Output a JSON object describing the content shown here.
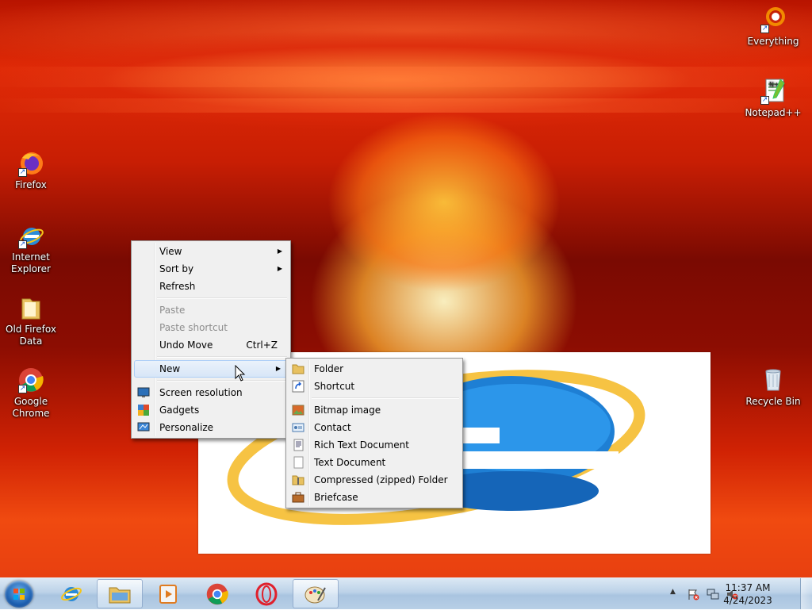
{
  "desktop": {
    "icons": [
      {
        "id": "everything",
        "label": "Everything",
        "icon": "everything-icon"
      },
      {
        "id": "notepadpp",
        "label": "Notepad++",
        "icon": "notepadpp-icon"
      },
      {
        "id": "firefox",
        "label": "Firefox",
        "icon": "firefox-icon"
      },
      {
        "id": "ie",
        "label_line1": "Internet",
        "label_line2": "Explorer",
        "icon": "internet-explorer-icon"
      },
      {
        "id": "oldff",
        "label_line1": "Old Firefox",
        "label_line2": "Data",
        "icon": "folder-icon"
      },
      {
        "id": "chrome",
        "label_line1": "Google",
        "label_line2": "Chrome",
        "icon": "chrome-icon"
      },
      {
        "id": "recycle",
        "label": "Recycle Bin",
        "icon": "recycle-bin-icon"
      }
    ]
  },
  "context_menu": {
    "view": "View",
    "sort_by": "Sort by",
    "refresh": "Refresh",
    "paste": "Paste",
    "paste_shortcut": "Paste shortcut",
    "undo_move": "Undo Move",
    "undo_move_shortcut": "Ctrl+Z",
    "new": "New",
    "screen_resolution": "Screen resolution",
    "gadgets": "Gadgets",
    "personalize": "Personalize"
  },
  "new_submenu": {
    "folder": "Folder",
    "shortcut": "Shortcut",
    "bitmap_image": "Bitmap image",
    "contact": "Contact",
    "rich_text_document": "Rich Text Document",
    "text_document": "Text Document",
    "compressed_folder": "Compressed (zipped) Folder",
    "briefcase": "Briefcase"
  },
  "taskbar": {
    "start": "start-orb-icon",
    "pinned": [
      "internet-explorer-icon",
      "file-explorer-icon",
      "media-player-icon",
      "chrome-icon",
      "opera-icon",
      "paint-icon"
    ],
    "clock_time": "11:37 AM",
    "clock_date": "4/24/2023"
  },
  "colors": {
    "menu_bg": "#f0f0f0",
    "menu_highlight": "#d8e6f7",
    "taskbar": "#bcd2e8"
  }
}
